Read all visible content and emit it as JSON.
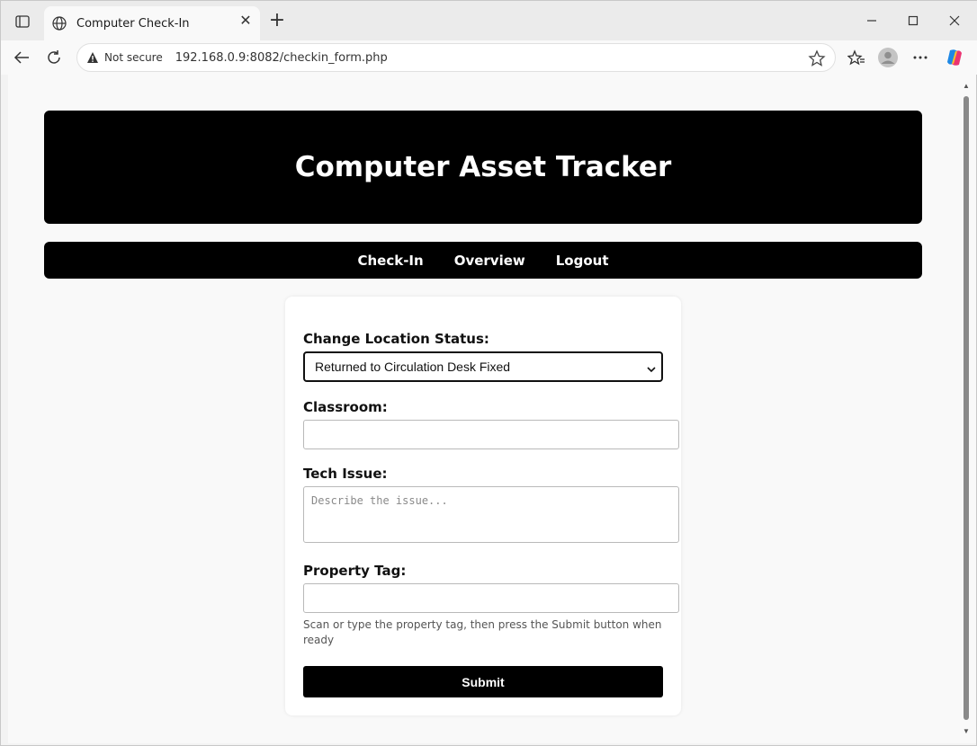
{
  "browser": {
    "tab_title": "Computer Check-In",
    "security_label": "Not secure",
    "url": "192.168.0.9:8082/checkin_form.php"
  },
  "header": {
    "title": "Computer Asset Tracker"
  },
  "nav": {
    "items": [
      {
        "label": "Check-In"
      },
      {
        "label": "Overview"
      },
      {
        "label": "Logout"
      }
    ]
  },
  "form": {
    "location_label": "Change Location Status:",
    "location_value": "Returned to Circulation Desk Fixed",
    "classroom_label": "Classroom:",
    "classroom_value": "",
    "tech_issue_label": "Tech Issue:",
    "tech_issue_placeholder": "Describe the issue...",
    "property_tag_label": "Property Tag:",
    "property_tag_value": "",
    "help_text": "Scan or type the property tag, then press the Submit button when ready",
    "submit_label": "Submit"
  }
}
